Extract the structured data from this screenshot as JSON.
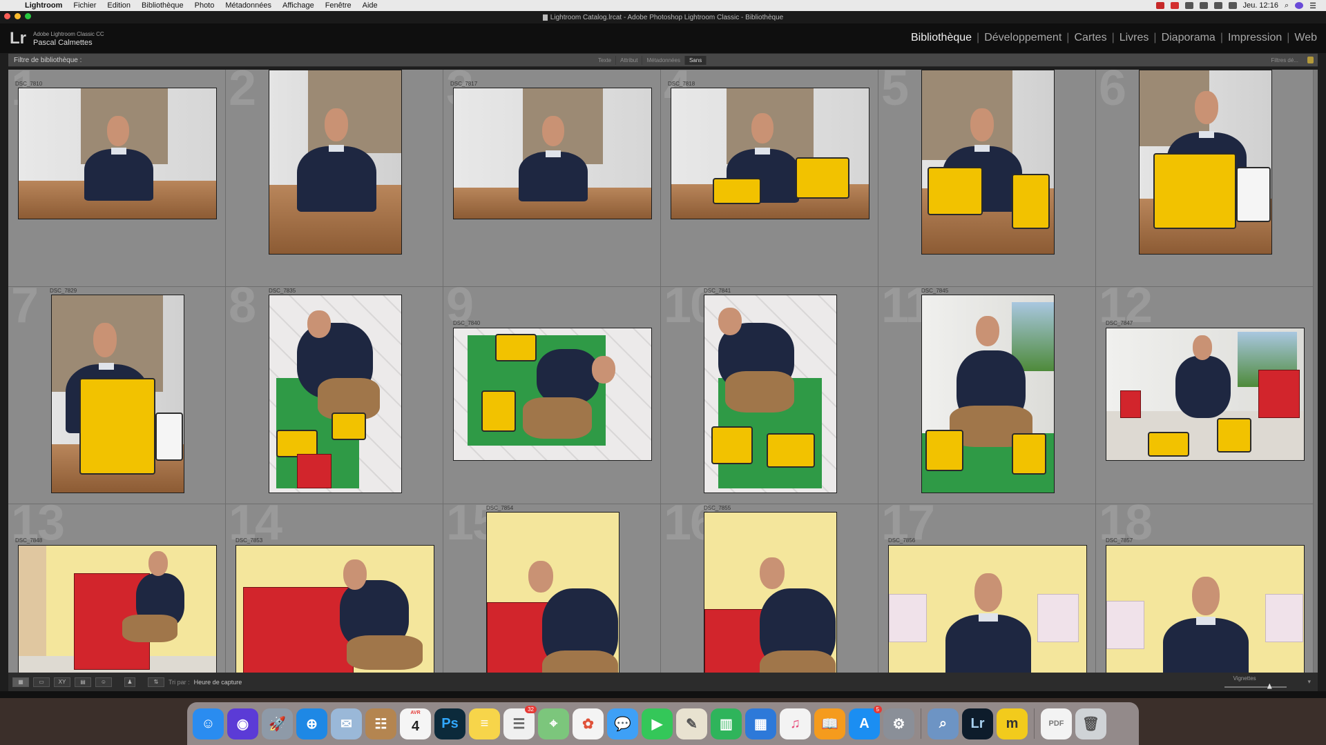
{
  "menubar": {
    "app": "Lightroom",
    "items": [
      "Fichier",
      "Edition",
      "Bibliothèque",
      "Photo",
      "Métadonnées",
      "Affichage",
      "Fenêtre",
      "Aide"
    ],
    "clock": "Jeu. 12:16"
  },
  "window": {
    "title": "Lightroom Catalog.lrcat - Adobe Photoshop Lightroom Classic - Bibliothèque"
  },
  "identity": {
    "logo": "Lr",
    "product": "Adobe Lightroom Classic CC",
    "user": "Pascal Calmettes"
  },
  "modules": [
    "Bibliothèque",
    "Développement",
    "Cartes",
    "Livres",
    "Diaporama",
    "Impression",
    "Web"
  ],
  "filter": {
    "label": "Filtre de bibliothèque :",
    "tabs": [
      "Texte",
      "Attribut",
      "Métadonnées",
      "Sans"
    ],
    "selected_tab": "Sans",
    "presets": "Filtres dé..."
  },
  "colors": {
    "grid_bg": "#7b7b7b",
    "cell_bg": "#8b8b8b",
    "sweater": "#1e2741",
    "toy_yellow": "#f2c200",
    "kitchen_red": "#d2252c",
    "wall_yellow": "#f4e69c"
  },
  "grid": {
    "cells": [
      {
        "num": "1",
        "file": "DSC_7810"
      },
      {
        "num": "2",
        "file": ""
      },
      {
        "num": "3",
        "file": "DSC_7817"
      },
      {
        "num": "4",
        "file": "DSC_7818"
      },
      {
        "num": "5",
        "file": ""
      },
      {
        "num": "6",
        "file": ""
      },
      {
        "num": "7",
        "file": "DSC_7829"
      },
      {
        "num": "8",
        "file": "DSC_7835"
      },
      {
        "num": "9",
        "file": "DSC_7840"
      },
      {
        "num": "10",
        "file": "DSC_7841"
      },
      {
        "num": "11",
        "file": "DSC_7845"
      },
      {
        "num": "12",
        "file": "DSC_7847"
      },
      {
        "num": "13",
        "file": "DSC_7848"
      },
      {
        "num": "14",
        "file": "DSC_7853"
      },
      {
        "num": "15",
        "file": "DSC_7854"
      },
      {
        "num": "16",
        "file": "DSC_7855"
      },
      {
        "num": "17",
        "file": "DSC_7856"
      },
      {
        "num": "18",
        "file": "DSC_7857"
      }
    ]
  },
  "toolbar": {
    "sort_label": "Tri par :",
    "sort_value": "Heure de capture",
    "thumb_size_label": "Vignettes",
    "thumb_size_fraction": 0.72
  },
  "dock": {
    "apps": [
      {
        "name": "Finder",
        "glyph": "☺",
        "color": "#2a8cf0"
      },
      {
        "name": "Siri",
        "glyph": "◉",
        "color": "#5b3bd6"
      },
      {
        "name": "Launchpad",
        "glyph": "🚀",
        "color": "#8e9aa8"
      },
      {
        "name": "Safari",
        "glyph": "⊕",
        "color": "#1e88e5"
      },
      {
        "name": "Mail",
        "glyph": "✉",
        "color": "#9ab8d8"
      },
      {
        "name": "Contacts",
        "glyph": "☷",
        "color": "#b48550"
      },
      {
        "name": "Calendar",
        "glyph": "4",
        "color": "#f5f5f5",
        "text_color": "#222",
        "sub": "AVR"
      },
      {
        "name": "Photoshop",
        "glyph": "Ps",
        "color": "#0c2a3b",
        "text_color": "#31a8ff"
      },
      {
        "name": "Notes",
        "glyph": "≡",
        "color": "#f7d54a"
      },
      {
        "name": "Reminders",
        "glyph": "☰",
        "color": "#f0f0f0",
        "text_color": "#666",
        "badge": "32"
      },
      {
        "name": "Maps",
        "glyph": "⌖",
        "color": "#7cc67c"
      },
      {
        "name": "Photos",
        "glyph": "✿",
        "color": "#f4f4f4",
        "text_color": "#e0523a"
      },
      {
        "name": "Messages",
        "glyph": "💬",
        "color": "#3ea0f6"
      },
      {
        "name": "FaceTime",
        "glyph": "▶",
        "color": "#34c759"
      },
      {
        "name": "TextEdit",
        "glyph": "✎",
        "color": "#e8e2d0",
        "text_color": "#555"
      },
      {
        "name": "Numbers",
        "glyph": "▥",
        "color": "#2fb45b"
      },
      {
        "name": "Keynote",
        "glyph": "▦",
        "color": "#2d79d9"
      },
      {
        "name": "iTunes",
        "glyph": "♫",
        "color": "#f3f3f3",
        "text_color": "#e84b7a"
      },
      {
        "name": "iBooks",
        "glyph": "📖",
        "color": "#f59b1d"
      },
      {
        "name": "App Store",
        "glyph": "A",
        "color": "#1b8ef2",
        "badge": "5"
      },
      {
        "name": "System Preferences",
        "glyph": "⚙",
        "color": "#8a8f98"
      },
      {
        "name": "Preview",
        "glyph": "⌕",
        "color": "#6d94c4"
      },
      {
        "name": "Lightroom",
        "glyph": "Lr",
        "color": "#0d1c2b",
        "text_color": "#a8d1f0"
      },
      {
        "name": "Mosaic",
        "glyph": "m",
        "color": "#f2cb1c",
        "text_color": "#333"
      },
      {
        "name": "PDF",
        "glyph": "PDF",
        "color": "#f3f3f3",
        "text_color": "#777"
      },
      {
        "name": "Trash",
        "glyph": "🗑",
        "color": "#cfd3d6",
        "text_color": "#555"
      }
    ]
  }
}
